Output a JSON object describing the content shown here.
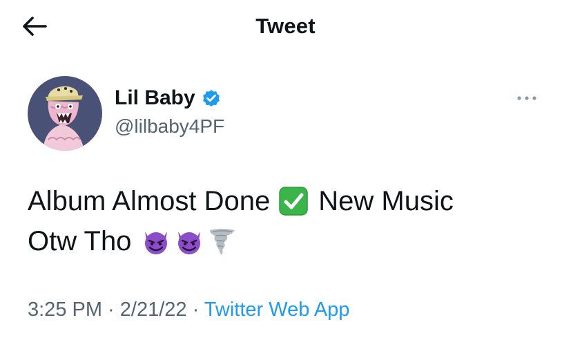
{
  "header": {
    "title": "Tweet"
  },
  "author": {
    "display_name": "Lil Baby",
    "handle": "@lilbaby4PF",
    "verified": true
  },
  "tweet": {
    "line1_part1": "Album Almost Done",
    "line1_part2": "New Music",
    "line2_part1": "Otw Tho",
    "emojis": [
      "check-mark-button",
      "smiling-face-with-horns",
      "smiling-face-with-horns",
      "tornado"
    ]
  },
  "meta": {
    "time": "3:25 PM",
    "sep1": " · ",
    "date": "2/21/22",
    "sep2": " · ",
    "source": "Twitter Web App"
  },
  "colors": {
    "accent": "#1d9bf0",
    "secondary_text": "#536471",
    "primary_text": "#0f1419",
    "verified_badge": "#1d9bf0",
    "check_emoji": "#3bb54a",
    "devil_emoji": "#8b4ec8"
  },
  "icons": {
    "back": "arrow-left-icon",
    "more": "more-dots-icon",
    "verified": "verified-badge-icon"
  }
}
